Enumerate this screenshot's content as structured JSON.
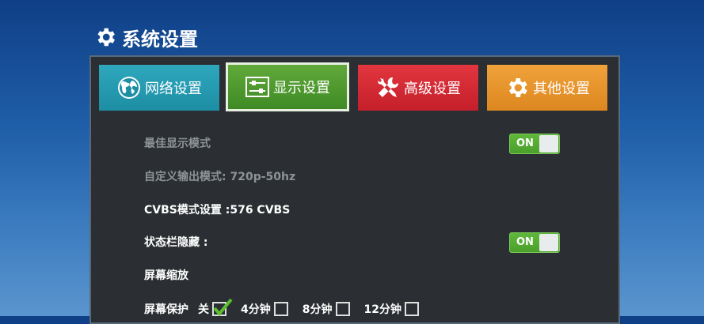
{
  "header": {
    "title": "系统设置"
  },
  "tabs": [
    {
      "label": "网络设置",
      "icon": "globe-icon",
      "color": "#1d8ea4"
    },
    {
      "label": "显示设置",
      "icon": "sliders-icon",
      "color": "#4f9a2e",
      "selected": true
    },
    {
      "label": "高级设置",
      "icon": "tools-icon",
      "color": "#d52a34"
    },
    {
      "label": "其他设置",
      "icon": "gear-icon",
      "color": "#e6942c"
    }
  ],
  "settings": {
    "best_mode": {
      "label": "最佳显示模式",
      "toggle": "ON"
    },
    "custom_output": {
      "label": "自定义输出模式:",
      "value": "720p-50hz"
    },
    "cvbs": {
      "label": "CVBS模式设置 :576 CVBS"
    },
    "status_bar": {
      "label": "状态栏隐藏 :",
      "toggle": "ON"
    },
    "zoom": {
      "label": "屏幕缩放"
    },
    "screensaver": {
      "label": "屏幕保护",
      "options": [
        {
          "label": "关",
          "checked": true
        },
        {
          "label": "4分钟",
          "checked": false
        },
        {
          "label": "8分钟",
          "checked": false
        },
        {
          "label": "12分钟",
          "checked": false
        }
      ]
    }
  }
}
